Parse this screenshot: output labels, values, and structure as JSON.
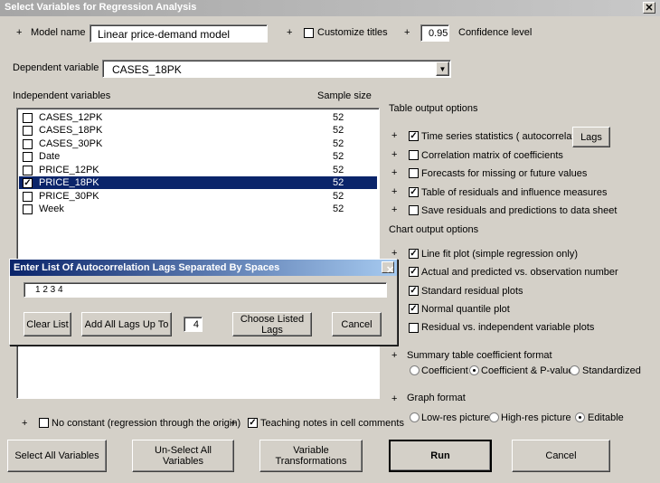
{
  "window": {
    "title": "Select Variables for Regression Analysis"
  },
  "top": {
    "plus": "+",
    "model_name_label": "Model name",
    "model_name_value": "Linear price-demand model",
    "customize_titles_label": "Customize titles",
    "confidence_value": "0.95",
    "confidence_label": "Confidence level"
  },
  "dependent": {
    "label": "Dependent variable",
    "value": "CASES_18PK"
  },
  "independent": {
    "label": "Independent variables",
    "size_label": "Sample size",
    "rows": [
      {
        "name": "CASES_12PK",
        "size": "52",
        "checked": false
      },
      {
        "name": "CASES_18PK",
        "size": "52",
        "checked": false
      },
      {
        "name": "CASES_30PK",
        "size": "52",
        "checked": false
      },
      {
        "name": "Date",
        "size": "52",
        "checked": false
      },
      {
        "name": "PRICE_12PK",
        "size": "52",
        "checked": false
      },
      {
        "name": "PRICE_18PK",
        "size": "52",
        "checked": true
      },
      {
        "name": "PRICE_30PK",
        "size": "52",
        "checked": false
      },
      {
        "name": "Week",
        "size": "52",
        "checked": false
      }
    ]
  },
  "table_options": {
    "label": "Table output options",
    "items": [
      {
        "label": "Time series statistics ( autocorrelations)",
        "checked": true
      },
      {
        "label": "Correlation matrix of coefficients",
        "checked": false
      },
      {
        "label": "Forecasts for missing or future values",
        "checked": false
      },
      {
        "label": "Table of residuals and influence measures",
        "checked": true
      },
      {
        "label": "Save residuals and predictions to data sheet",
        "checked": false
      }
    ],
    "lags_button": "Lags"
  },
  "chart_options": {
    "label": "Chart output options",
    "items": [
      {
        "label": "Line fit plot (simple regression only)",
        "checked": true
      },
      {
        "label": "Actual and predicted vs. observation number",
        "checked": true
      },
      {
        "label": "Standard residual plots",
        "checked": true
      },
      {
        "label": "Normal quantile plot",
        "checked": true
      },
      {
        "label": "Residual vs. independent variable plots",
        "checked": false
      }
    ]
  },
  "coef_format": {
    "label": "Summary table coefficient format",
    "options": [
      "Coefficient",
      "Coefficient & P-value",
      "Standardized"
    ],
    "selected": 1
  },
  "graph_format": {
    "label": "Graph format",
    "options": [
      "Low-res picture",
      "High-res picture",
      "Editable"
    ],
    "selected": 2
  },
  "bottom_checks": {
    "no_constant": "No constant (regression through the origin)",
    "teaching_notes": "Teaching notes in cell comments"
  },
  "buttons": {
    "select_all": "Select All Variables",
    "unselect_all": "Un-Select All Variables",
    "transform": "Variable Transformations",
    "run": "Run",
    "cancel": "Cancel"
  },
  "lag_dialog": {
    "title": "Enter List Of Autocorrelation Lags Separated By Spaces",
    "lags_value": "1 2 3 4",
    "clear": "Clear List",
    "add_all": "Add All Lags Up To",
    "max_lag": "4",
    "choose": "Choose Listed Lags",
    "cancel": "Cancel"
  }
}
